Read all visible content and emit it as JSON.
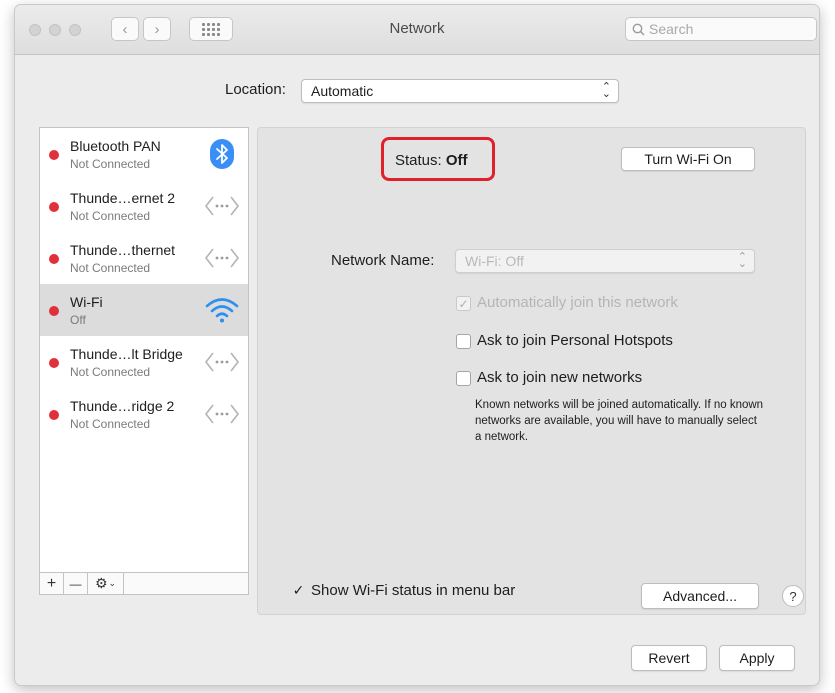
{
  "window": {
    "title": "Network"
  },
  "toolbar": {
    "search_placeholder": "Search",
    "back_glyph": "‹",
    "forward_glyph": "›"
  },
  "location": {
    "label": "Location:",
    "value": "Automatic"
  },
  "services": [
    {
      "name": "Bluetooth PAN",
      "status": "Not Connected",
      "icon": "bluetooth-icon",
      "status_color": "#e0303a"
    },
    {
      "name": "Thunde…ernet 2",
      "status": "Not Connected",
      "icon": "ethernet-icon",
      "status_color": "#e0303a"
    },
    {
      "name": "Thunde…thernet",
      "status": "Not Connected",
      "icon": "ethernet-icon",
      "status_color": "#e0303a"
    },
    {
      "name": "Wi-Fi",
      "status": "Off",
      "icon": "wifi-icon",
      "status_color": "#e0303a",
      "selected": true
    },
    {
      "name": "Thunde…lt Bridge",
      "status": "Not Connected",
      "icon": "ethernet-icon",
      "status_color": "#e0303a"
    },
    {
      "name": "Thunde…ridge 2",
      "status": "Not Connected",
      "icon": "ethernet-icon",
      "status_color": "#e0303a"
    }
  ],
  "sidebar_footer": {
    "add": "+",
    "remove": "—",
    "gear": "⚙"
  },
  "detail": {
    "status_label": "Status:",
    "status_value": "Off",
    "turn_on_button": "Turn Wi-Fi On",
    "network_name_label": "Network Name:",
    "network_name_value": "Wi-Fi: Off",
    "auto_join_label": "Automatically join this network",
    "auto_join_checked": true,
    "auto_join_enabled": false,
    "hotspots_label": "Ask to join Personal Hotspots",
    "hotspots_checked": false,
    "ask_new_label": "Ask to join new networks",
    "ask_new_checked": false,
    "note": "Known networks will be joined automatically. If no known networks are available, you will have to manually select a network.",
    "show_status_label": "Show Wi-Fi status in menu bar",
    "show_status_checked": true,
    "advanced_button": "Advanced...",
    "help_button": "?"
  },
  "footer": {
    "revert": "Revert",
    "apply": "Apply"
  },
  "colors": {
    "status_highlight": "#e0202b",
    "disconnected_dot": "#e0303a",
    "wifi_blue": "#2d8ff0",
    "bluetooth_blue": "#3a8ff7"
  }
}
